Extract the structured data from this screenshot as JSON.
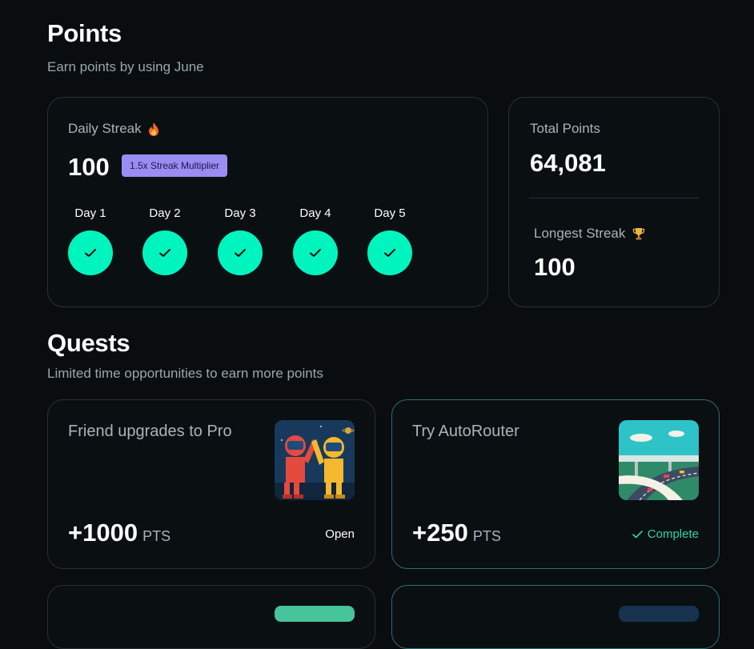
{
  "points": {
    "title": "Points",
    "subtitle": "Earn points by using June"
  },
  "streak": {
    "label": "Daily Streak",
    "icon": "fire-icon",
    "value": "100",
    "multiplier": "1.5x Streak Multiplier",
    "days": [
      {
        "label": "Day 1",
        "completed": true
      },
      {
        "label": "Day 2",
        "completed": true
      },
      {
        "label": "Day 3",
        "completed": true
      },
      {
        "label": "Day 4",
        "completed": true
      },
      {
        "label": "Day 5",
        "completed": true
      }
    ]
  },
  "totals": {
    "total_label": "Total Points",
    "total_value": "64,081",
    "longest_label": "Longest Streak",
    "longest_icon": "trophy-icon",
    "longest_value": "100"
  },
  "quests": {
    "title": "Quests",
    "subtitle": "Limited time opportunities to earn more points",
    "items": [
      {
        "title": "Friend upgrades to Pro",
        "points": "+1000",
        "unit": "PTS",
        "status": "Open",
        "image": "astronauts-high-five-illustration"
      },
      {
        "title": "Try AutoRouter",
        "points": "+250",
        "unit": "PTS",
        "status": "Complete",
        "image": "highway-illustration"
      }
    ]
  },
  "colors": {
    "background": "#090d10",
    "accent": "#00f5be",
    "badge": "#9b8cf4",
    "complete": "#2fd59f",
    "card_border": "#2a3034"
  }
}
